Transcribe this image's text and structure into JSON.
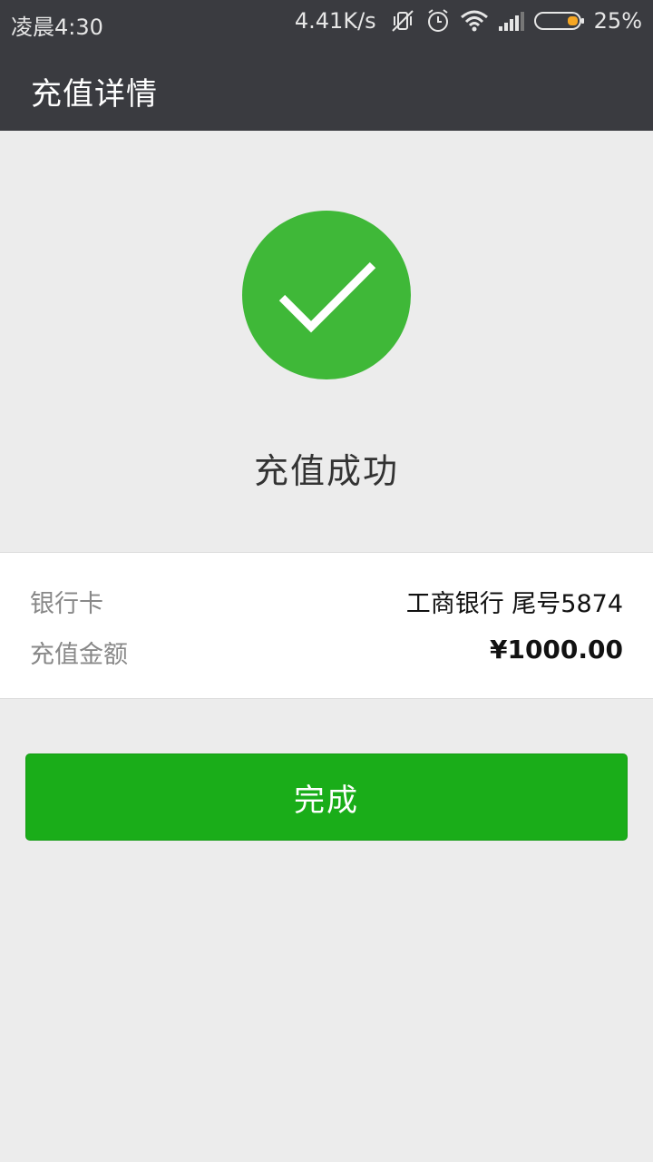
{
  "status_bar": {
    "time": "凌晨4:30",
    "network_speed": "4.41K/s",
    "battery_percent": "25%",
    "icons": [
      "muted-vibrate-icon",
      "alarm-icon",
      "wifi-icon",
      "signal-icon",
      "battery-icon"
    ]
  },
  "app_bar": {
    "title": "充值详情"
  },
  "result": {
    "icon": "check-circle-icon",
    "text": "充值成功",
    "color": "#3fb838"
  },
  "details": {
    "bank_card_label": "银行卡",
    "bank_card_value": "工商银行 尾号5874",
    "amount_label": "充值金额",
    "amount_value": "¥1000.00"
  },
  "actions": {
    "done_label": "完成",
    "done_color": "#1aad19"
  }
}
